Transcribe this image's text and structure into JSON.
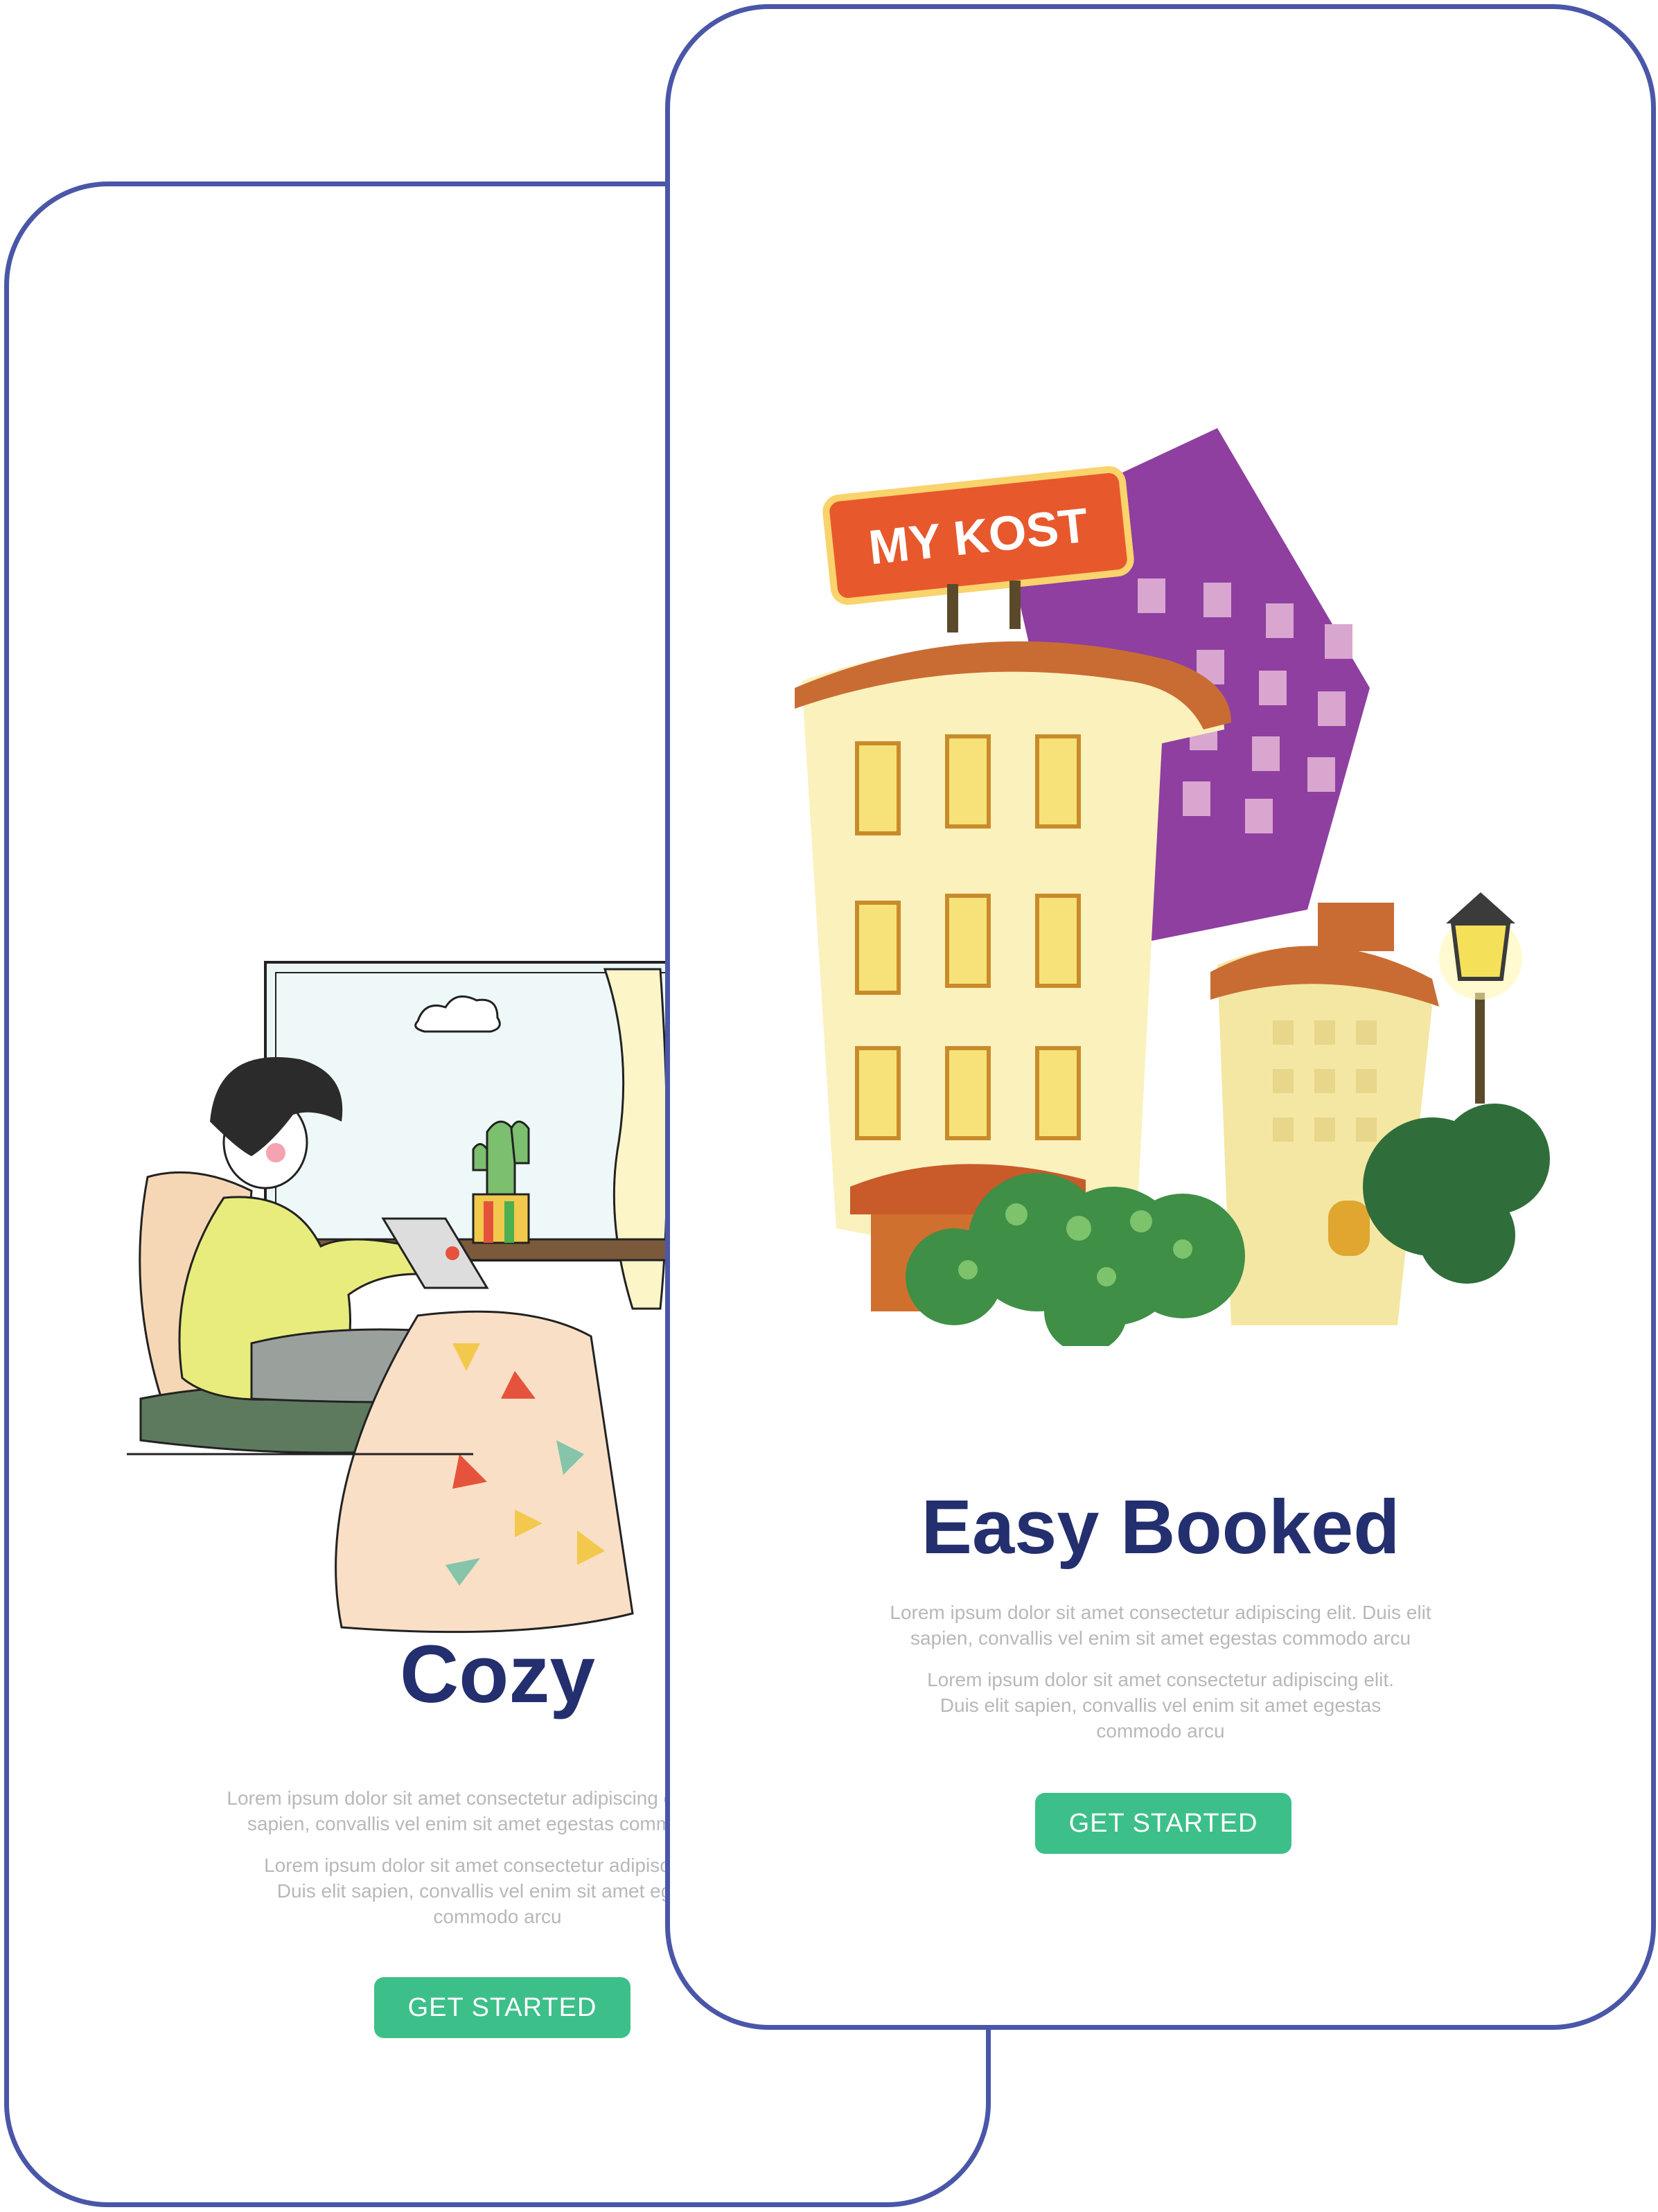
{
  "back_screen": {
    "title": "Cozy",
    "para1": [
      "Lorem  ipsum  dolor  sit  amet consectetur adipiscing elit. Duis elit",
      "sapien, convallis vel enim sit amet egestas commodo arcu"
    ],
    "para2": [
      "Lorem  ipsum  dolor  sit  amet consectetur adipiscing elit.",
      "Duis elit sapien, convallis vel enim sit amet egestas",
      "commodo arcu"
    ],
    "button": "GET STARTED"
  },
  "front_screen": {
    "title": "Easy Booked",
    "sign_text": "MY KOST",
    "para1": [
      "Lorem  ipsum  dolor  sit  amet consectetur adipiscing elit. Duis elit",
      "sapien, convallis vel enim sit amet egestas commodo arcu"
    ],
    "para2": [
      "Lorem  ipsum  dolor  sit  amet consectetur adipiscing elit.",
      "Duis elit sapien, convallis vel enim sit amet egestas",
      "commodo arcu"
    ],
    "button": "GET STARTED"
  },
  "colors": {
    "border": "#4a56a8",
    "title": "#232f6e",
    "button": "#3dbf8a",
    "body_text": "#b8b8b8"
  }
}
